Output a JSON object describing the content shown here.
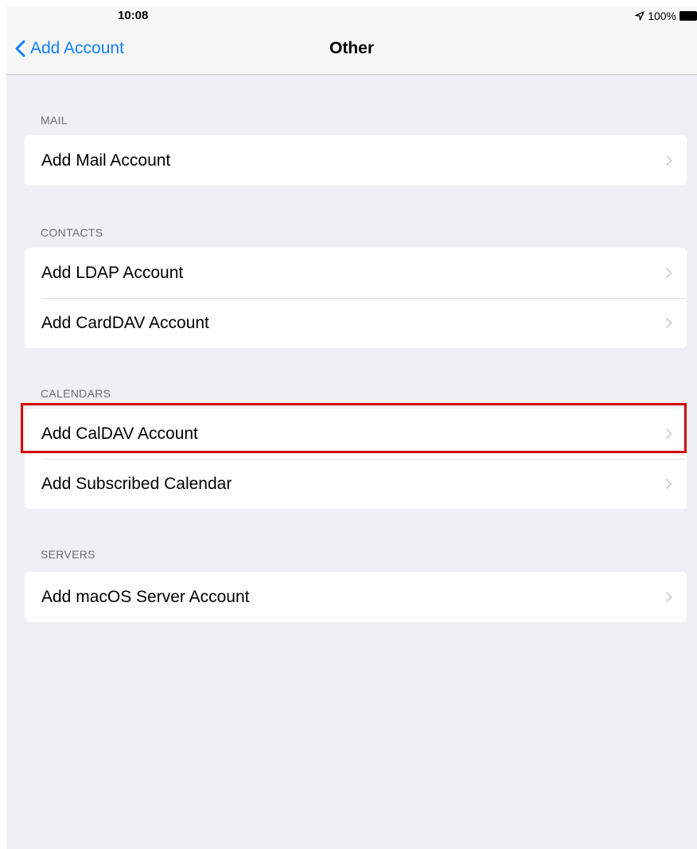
{
  "status_bar": {
    "time": "10:08",
    "battery": "100%"
  },
  "nav": {
    "back_label": "Add Account",
    "title": "Other"
  },
  "sections": {
    "mail": {
      "header": "MAIL",
      "rows": [
        "Add Mail Account"
      ]
    },
    "contacts": {
      "header": "CONTACTS",
      "rows": [
        "Add LDAP Account",
        "Add CardDAV Account"
      ]
    },
    "calendars": {
      "header": "CALENDARS",
      "rows": [
        "Add CalDAV Account",
        "Add Subscribed Calendar"
      ]
    },
    "servers": {
      "header": "SERVERS",
      "rows": [
        "Add macOS Server Account"
      ]
    }
  },
  "colors": {
    "accent": "#147efb",
    "background": "#efeff4",
    "highlight": "#d10000"
  },
  "icons": [
    "location-arrow-icon",
    "battery-icon",
    "chevron-left-icon",
    "chevron-right-icon"
  ]
}
